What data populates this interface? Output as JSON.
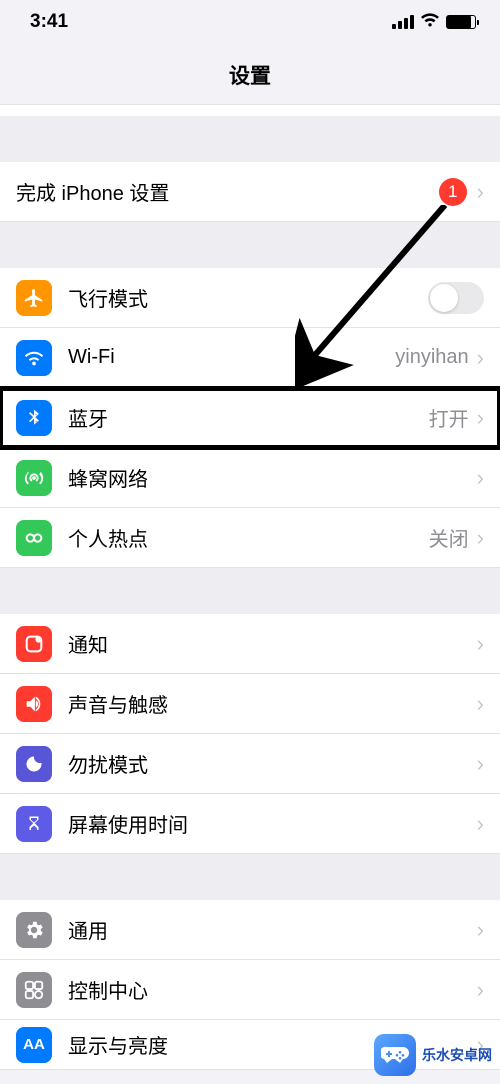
{
  "status_bar": {
    "time": "3:41"
  },
  "page": {
    "title": "设置"
  },
  "groups": {
    "setup": {
      "finish_label": "完成 iPhone 设置",
      "finish_badge": "1"
    },
    "network": {
      "airplane_label": "飞行模式",
      "wifi_label": "Wi-Fi",
      "wifi_value": "yinyihan",
      "bluetooth_label": "蓝牙",
      "bluetooth_value": "打开",
      "cellular_label": "蜂窝网络",
      "hotspot_label": "个人热点",
      "hotspot_value": "关闭"
    },
    "notifications": {
      "notify_label": "通知",
      "sound_label": "声音与触感",
      "dnd_label": "勿扰模式",
      "screentime_label": "屏幕使用时间"
    },
    "general": {
      "general_label": "通用",
      "control_center_label": "控制中心",
      "display_label": "显示与亮度"
    }
  },
  "watermark": {
    "text": "乐水安卓网"
  }
}
